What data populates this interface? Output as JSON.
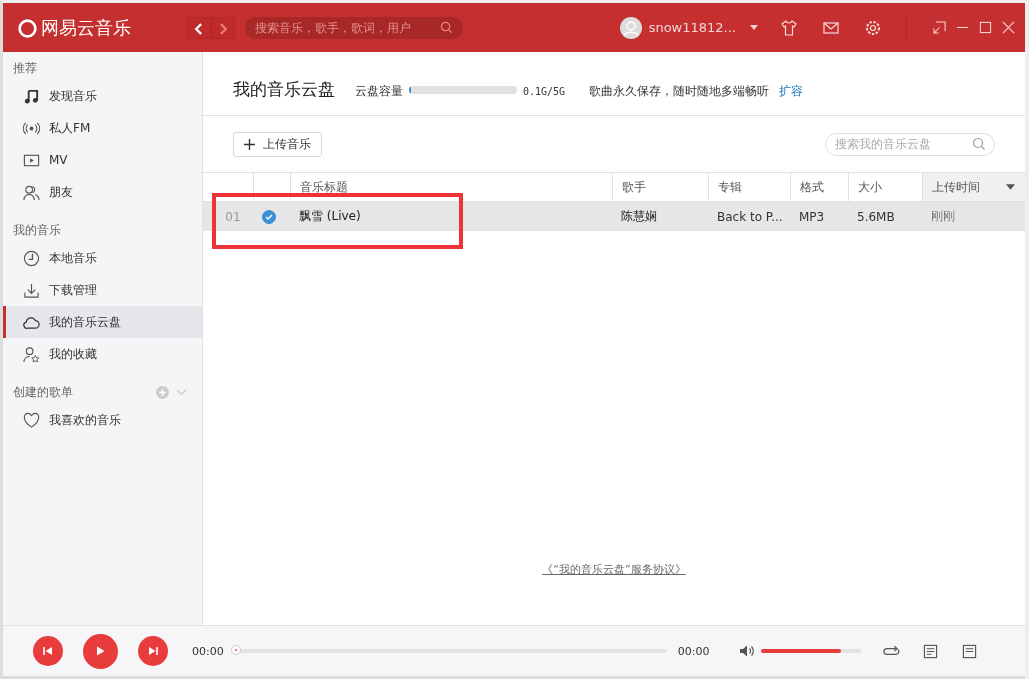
{
  "app": {
    "logo": "网易云音乐",
    "search": {
      "placeholder": "搜索音乐，歌手，歌词，用户"
    },
    "user": "snow11812..."
  },
  "sidebar": {
    "sections": [
      {
        "title": "推荐",
        "items": [
          {
            "label": "发现音乐",
            "selected": false
          },
          {
            "label": "私人FM",
            "selected": false
          },
          {
            "label": "MV",
            "selected": false
          },
          {
            "label": "朋友",
            "selected": false
          }
        ]
      },
      {
        "title": "我的音乐",
        "items": [
          {
            "label": "本地音乐",
            "selected": false
          },
          {
            "label": "下载管理",
            "selected": false
          },
          {
            "label": "我的音乐云盘",
            "selected": true
          },
          {
            "label": "我的收藏",
            "selected": false
          }
        ]
      },
      {
        "title": "创建的歌单",
        "items": [
          {
            "label": "我喜欢的音乐",
            "selected": false
          }
        ]
      }
    ]
  },
  "page": {
    "title": "我的音乐云盘",
    "capacity_label": "云盘容量",
    "capacity": {
      "level": 0.02
    },
    "capacity_text": "0.1G/5G",
    "slogan": "歌曲永久保存，随时随地多端畅听",
    "expand_link": "扩容",
    "upload_button": "上传音乐",
    "search": {
      "placeholder": "搜索我的音乐云盘"
    }
  },
  "table": {
    "columns": [
      "音乐标题",
      "歌手",
      "专辑",
      "格式",
      "大小",
      "上传时间"
    ],
    "rows": [
      {
        "index": "01",
        "checked": true,
        "title": "飘雪 (Live)",
        "singer": "陈慧娴",
        "album": "Back to P...",
        "format": "MP3",
        "size": "5.6MB",
        "uploaded": "刚刚",
        "selected": true
      }
    ]
  },
  "agreement_link": "《“我的音乐云盘”服务协议》",
  "player": {
    "elapsed": "00:00",
    "progress": {
      "level": 0
    },
    "duration": "00:00",
    "volume": {
      "level": 0.8
    }
  },
  "annotation": {
    "highlight": true
  }
}
